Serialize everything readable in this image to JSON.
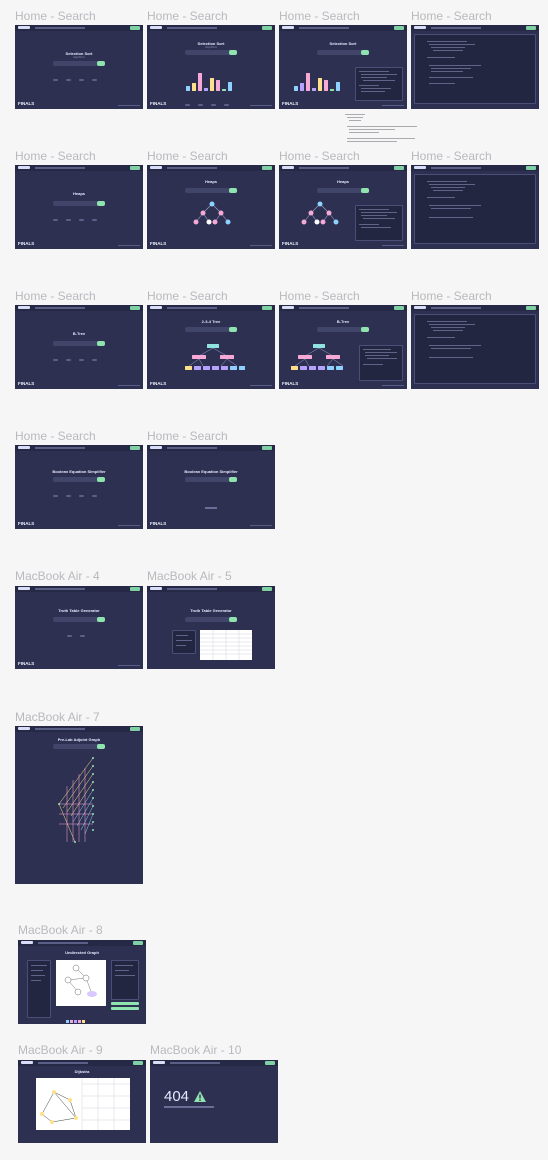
{
  "frames": [
    {
      "label": "Home - Search",
      "title": "Selection Sort",
      "subtitle": "Algorithms"
    },
    {
      "label": "Home - Search",
      "title": "Selection Sort",
      "subtitle": "Algorithms"
    },
    {
      "label": "Home - Search",
      "title": "Selection Sort",
      "subtitle": "Algorithms"
    },
    {
      "label": "Home - Search",
      "title": "",
      "subtitle": ""
    },
    {
      "label": "Home - Search",
      "title": "Heaps",
      "subtitle": ""
    },
    {
      "label": "Home - Search",
      "title": "Heaps",
      "subtitle": ""
    },
    {
      "label": "Home - Search",
      "title": "Heaps",
      "subtitle": ""
    },
    {
      "label": "Home - Search",
      "title": "",
      "subtitle": ""
    },
    {
      "label": "Home - Search",
      "title": "B-Tree",
      "subtitle": ""
    },
    {
      "label": "Home - Search",
      "title": "2-3-4 Tree",
      "subtitle": ""
    },
    {
      "label": "Home - Search",
      "title": "B-Tree",
      "subtitle": ""
    },
    {
      "label": "Home - Search",
      "title": "",
      "subtitle": ""
    },
    {
      "label": "Home - Search",
      "title": "Boolean Equation Simplifier",
      "subtitle": ""
    },
    {
      "label": "Home - Search",
      "title": "Boolean Equation Simplifier",
      "subtitle": ""
    },
    {
      "label": "MacBook Air - 4",
      "title": "Truth Table Generator",
      "subtitle": ""
    },
    {
      "label": "MacBook Air - 5",
      "title": "Truth Table Generator",
      "subtitle": ""
    },
    {
      "label": "MacBook Air - 7",
      "title": "Pre-Lab Adjoint Graph",
      "subtitle": ""
    },
    {
      "label": "MacBook Air - 8",
      "title": "Undirected Graph",
      "subtitle": ""
    },
    {
      "label": "MacBook Air - 9",
      "title": "Dijkstra",
      "subtitle": ""
    },
    {
      "label": "MacBook Air - 10",
      "title": "404",
      "subtitle": ""
    }
  ],
  "brand": "FINALS",
  "error_code": "404",
  "colors": {
    "canvas": "#f6f6f7",
    "frame": "#2d3050",
    "accent": "#8fe3ae",
    "pink": "#f6a8d6",
    "yellow": "#ffe08a",
    "blue": "#8fd1ff",
    "purple": "#b6a3ff"
  }
}
